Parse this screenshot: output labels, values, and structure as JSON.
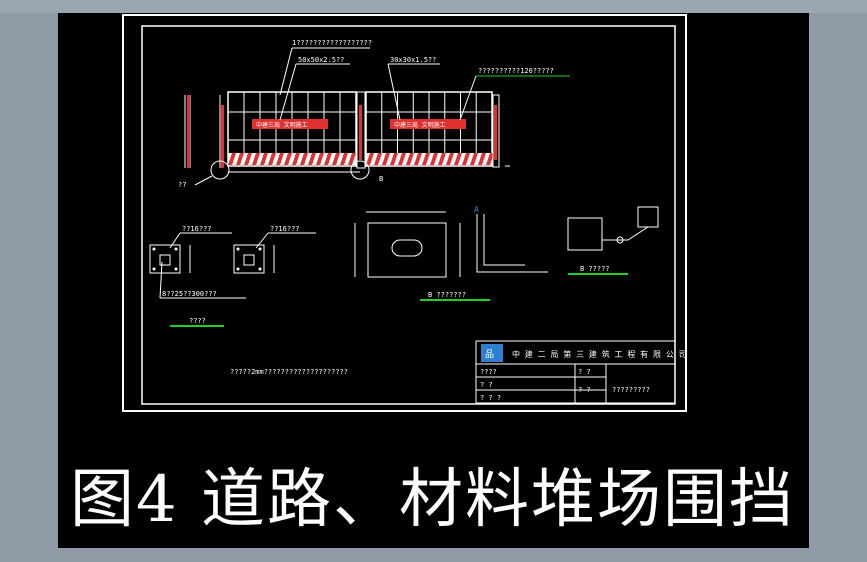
{
  "drawing": {
    "labels": {
      "top_note": "1??????????????????",
      "tube_a": "50x50x2.5??",
      "tube_b": "30x30x1.5??",
      "panel_note": "??????????120?????",
      "left_dim": "??",
      "bottom_dim_marker": "B",
      "sign_text_a": "中建三局  文明施工",
      "sign_text_b": "中建三局  文明施工",
      "plate_a": "??16???",
      "plate_b": "??16???",
      "plate_dim": "8??25??300???",
      "plate_title": "????",
      "detail_b_title": "B ?????",
      "detail_b_marker": "B",
      "detail_a_title": "B ???????",
      "detail_a_marker": "A",
      "footnote": "?????2mm????????????????????"
    },
    "title_block": {
      "company": "中 建 二 局 第 三 建 筑 工 程 有 限 公 司",
      "row1_left": "????",
      "row1_mid": "?  ?",
      "row2_left": "?   ?",
      "row2_mid": "?    ?",
      "row2_right": "?????????",
      "row3_left": "?  ? ?"
    }
  },
  "caption": "图4  道路、材料堆场围挡",
  "colors": {
    "background": "#000000",
    "frame": "#ffffff",
    "accent_red": "#e03030",
    "accent_green": "#1fd11f",
    "accent_blue": "#2f7fd0"
  }
}
